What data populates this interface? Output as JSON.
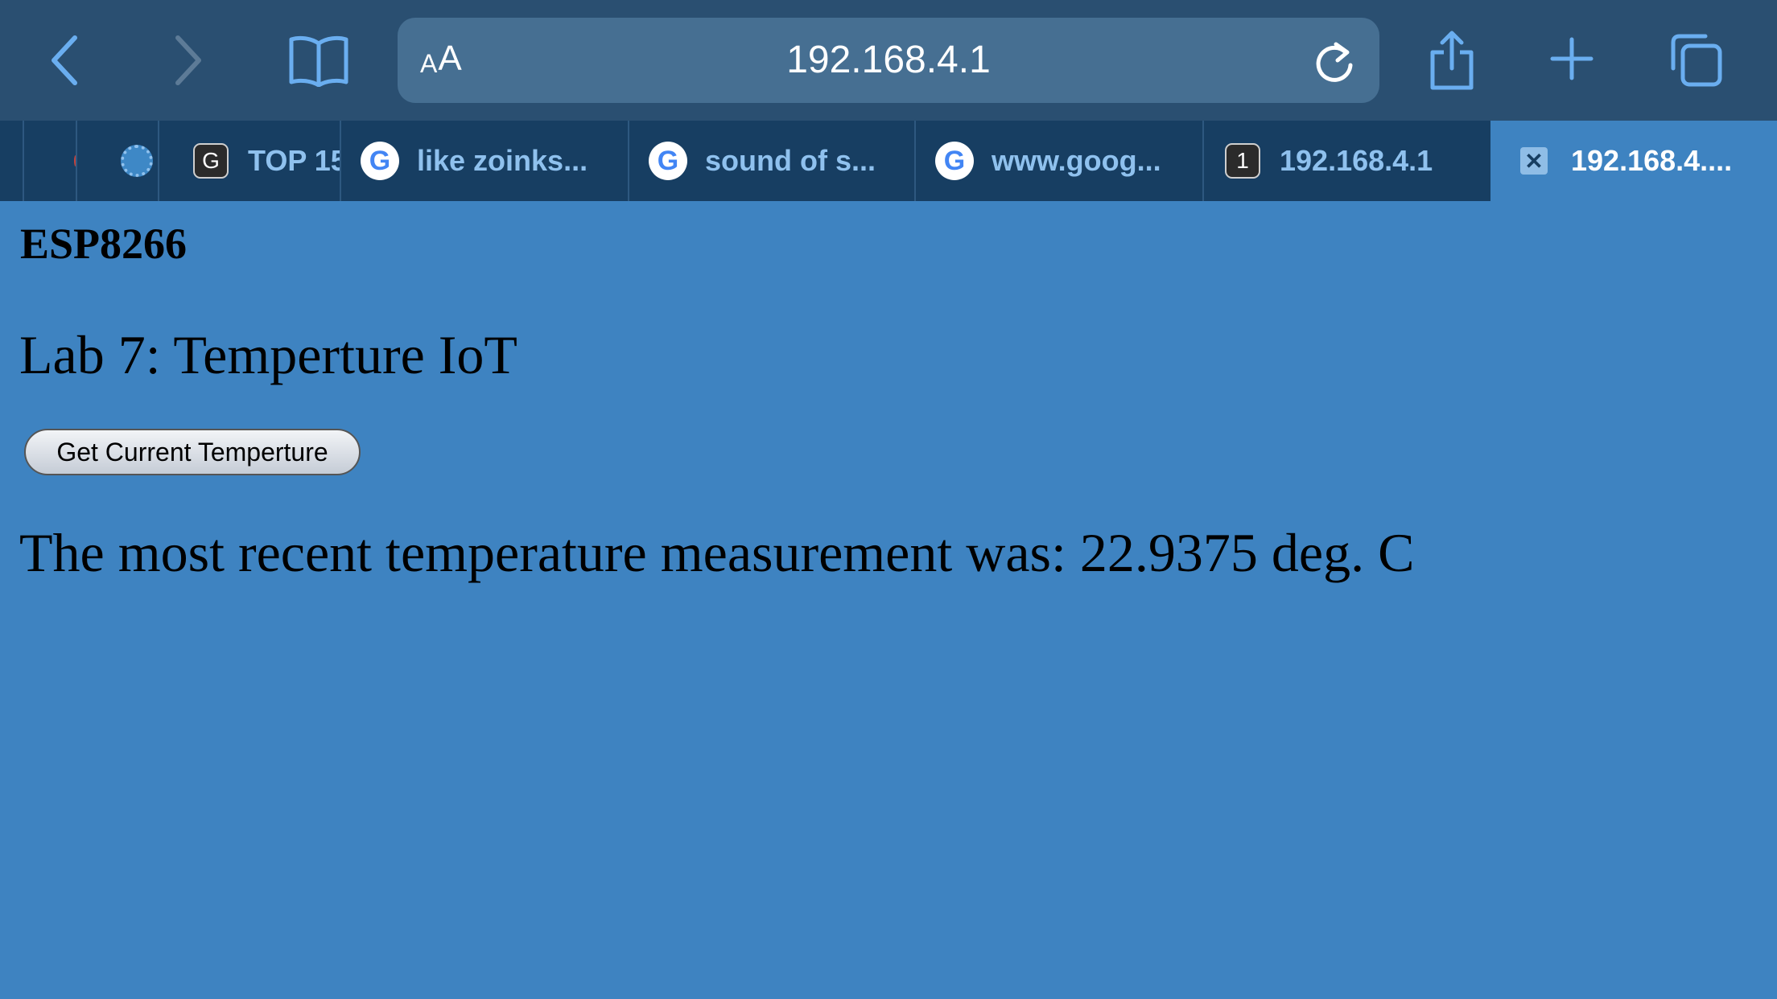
{
  "browser": {
    "address_bar": {
      "text_size_small": "A",
      "text_size_large": "A",
      "url": "192.168.4.1"
    },
    "tabs": [
      {
        "label": "TOP 15",
        "favicon": "g-letter-icon"
      },
      {
        "label": "like zoinks...",
        "favicon": "google-icon"
      },
      {
        "label": "sound of s...",
        "favicon": "google-icon"
      },
      {
        "label": "www.goog...",
        "favicon": "google-icon"
      },
      {
        "label": "192.168.4.1",
        "favicon": "one-badge-icon",
        "favicon_text": "1"
      },
      {
        "label": "192.168.4....",
        "favicon": "close-tab-icon",
        "active": true
      }
    ],
    "favicon_letters": {
      "g_box": "G",
      "google": "G"
    }
  },
  "page": {
    "title": "ESP8266",
    "subtitle": "Lab 7: Temperture IoT",
    "button_label": "Get Current Temperture",
    "reading_text": "The most recent temperature measurement was: 22.9375 deg. C"
  },
  "colors": {
    "toolbar": "#2a4f71",
    "address_bar": "#466f92",
    "tab_strip": "#173e62",
    "page_background": "#3e83c1",
    "icon_blue": "#7db8ee"
  }
}
